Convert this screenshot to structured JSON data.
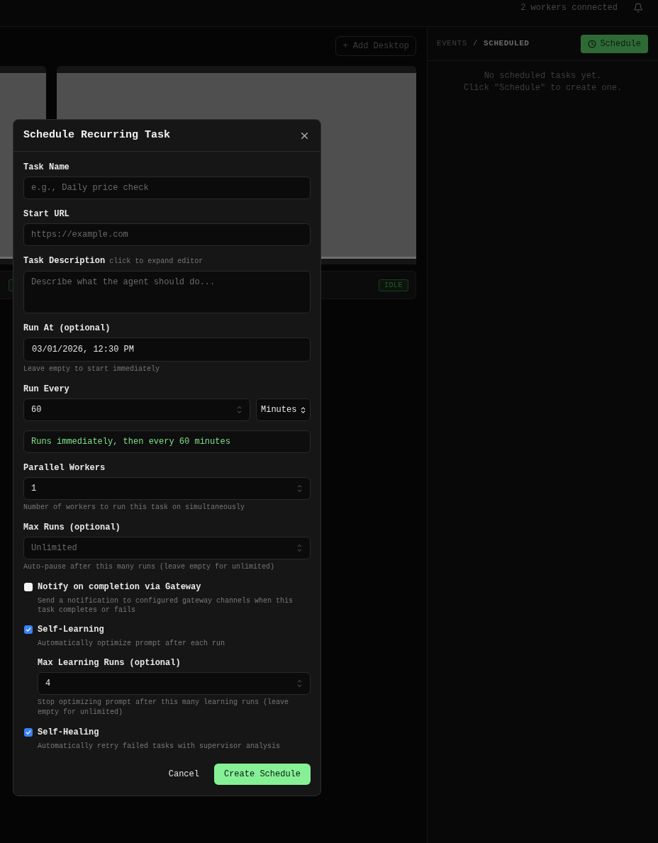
{
  "header": {
    "status": "2 workers connected"
  },
  "workspace": {
    "add_button": "+ Add Desktop",
    "status": "IDLE"
  },
  "panel": {
    "tabs": [
      {
        "label": "EVENTS",
        "selected": false
      },
      {
        "label": "SCHEDULED",
        "selected": true
      }
    ],
    "separator": "/",
    "schedule_button": "Schedule",
    "empty_lines": [
      "No scheduled tasks yet.",
      "Click \"Schedule\" to create one."
    ]
  },
  "modal": {
    "title": "Schedule Recurring Task",
    "fields": [
      {
        "kind": "text",
        "label": "Task Name",
        "placeholder": "e.g., Daily price check"
      },
      {
        "kind": "text",
        "label": "Start URL",
        "placeholder": "https://example.com"
      },
      {
        "kind": "textarea",
        "label": "Task Description",
        "label_hint": "click to expand editor",
        "placeholder": "Describe what the agent should do..."
      },
      {
        "kind": "datetime",
        "label": "Run At (optional)",
        "value": "03/01/2026, 12:30 PM",
        "hint": "Leave empty to start immediately"
      },
      {
        "kind": "interval",
        "label": "Run Every",
        "value": "60",
        "unit": "Minutes"
      },
      {
        "kind": "notice",
        "text": "Runs immediately, then every 60 minutes"
      },
      {
        "kind": "number",
        "label": "Parallel Workers",
        "value": "1",
        "hint": "Number of workers to run this task on simultaneously"
      },
      {
        "kind": "number",
        "label": "Max Runs (optional)",
        "placeholder": "Unlimited",
        "hint": "Auto-pause after this many runs (leave empty for unlimited)"
      },
      {
        "kind": "checkbox",
        "label": "Notify on completion via Gateway",
        "checked": false,
        "description": "Send a notification to configured gateway channels when this task completes or fails"
      },
      {
        "kind": "checkbox",
        "label": "Self-Learning",
        "checked": true,
        "description": "Automatically optimize prompt after each run",
        "children": [
          {
            "kind": "number",
            "label": "Max Learning Runs (optional)",
            "value": "4",
            "hint": "Stop optimizing prompt after this many learning runs (leave empty for unlimited)"
          }
        ]
      },
      {
        "kind": "checkbox",
        "label": "Self-Healing",
        "checked": true,
        "description": "Automatically retry failed tasks with supervisor analysis"
      }
    ],
    "buttons": [
      {
        "kind": "secondary",
        "label": "Cancel"
      },
      {
        "kind": "primary",
        "label": "Create Schedule"
      }
    ]
  }
}
